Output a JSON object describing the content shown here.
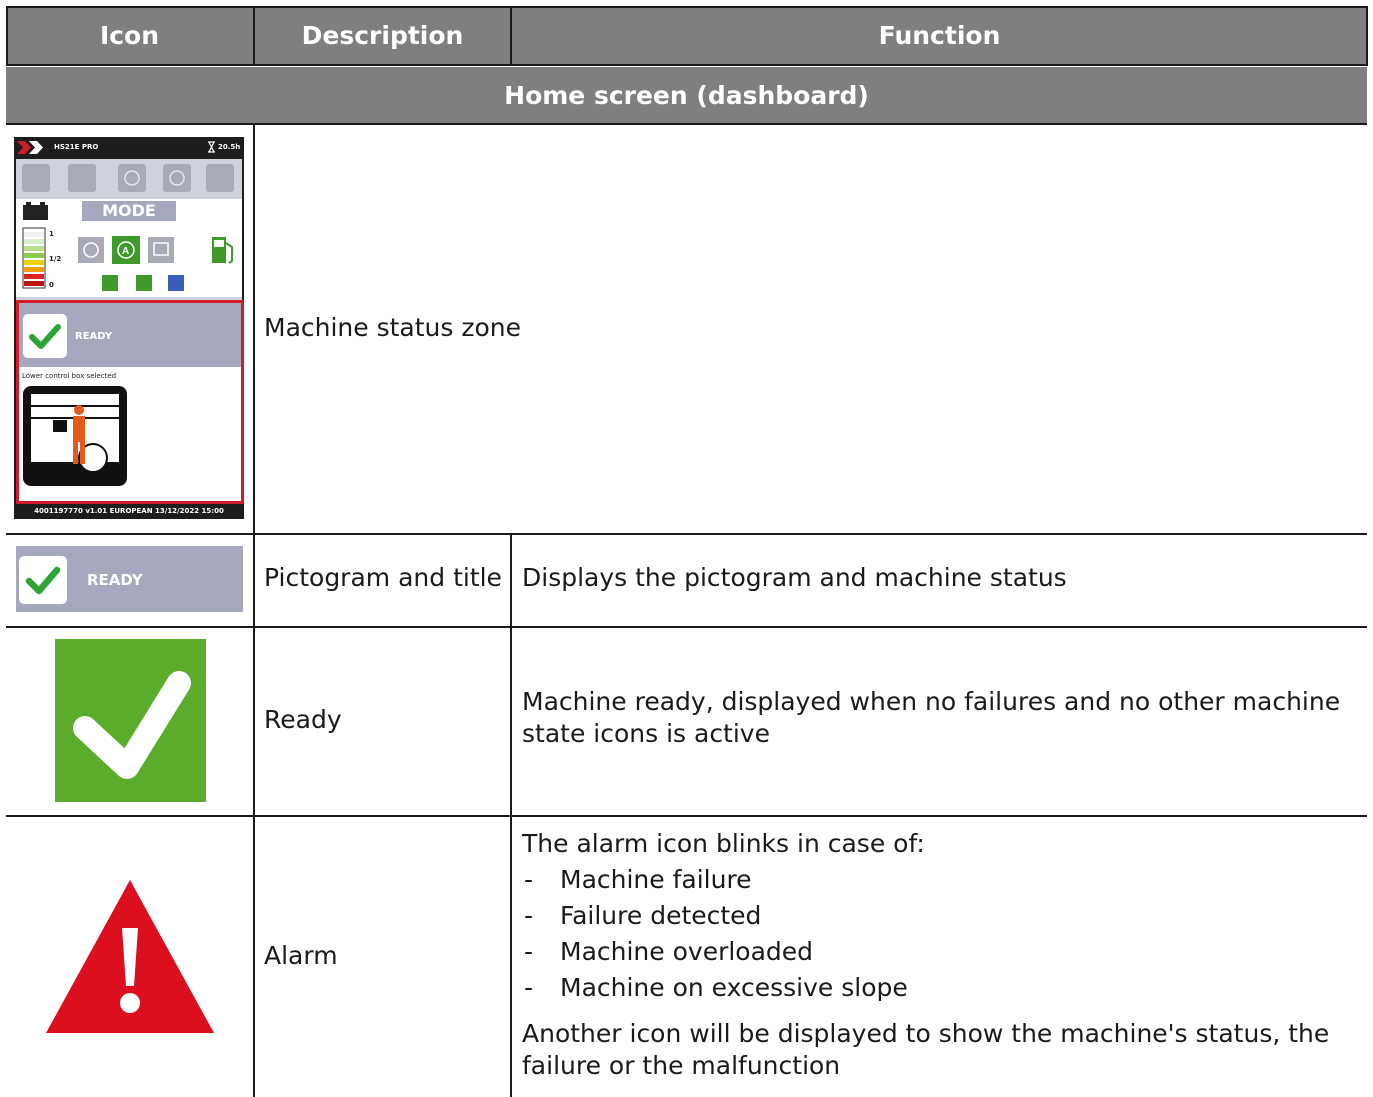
{
  "table": {
    "headers": {
      "icon": "Icon",
      "description": "Description",
      "function": "Function"
    },
    "section_title": "Home screen (dashboard)",
    "rows": [
      {
        "description": "Machine status zone",
        "function": ""
      },
      {
        "description": "Pictogram and title",
        "function": "Displays the pictogram and machine status"
      },
      {
        "description": "Ready",
        "function": "Machine ready, displayed when no failures and no other machine state icons is active"
      },
      {
        "description": "Alarm",
        "function_intro": "The alarm icon blinks in case of:",
        "function_list": [
          "Machine failure",
          "Failure detected",
          "Machine overloaded",
          "Machine on excessive slope"
        ],
        "function_outro": "Another icon will be displayed to show the machine's status, the failure or the malfunction"
      }
    ]
  },
  "screen": {
    "model": "HS21E PRO",
    "hours": "20.5h",
    "mode_label": "MODE",
    "gauge_labels": [
      "1",
      "1/2",
      "0"
    ],
    "status_label": "READY",
    "status_message": "Lower control box selected",
    "footer": "4001197770  v1.01  EUROPEAN  13/12/2022  15:00"
  },
  "pictogram": {
    "label": "READY"
  },
  "colors": {
    "header_bg": "#7f7f7f",
    "ready_green": "#5aac2a",
    "check_green": "#2ea336",
    "alarm_red": "#dc0f1e",
    "status_bar": "#a6a8be"
  }
}
